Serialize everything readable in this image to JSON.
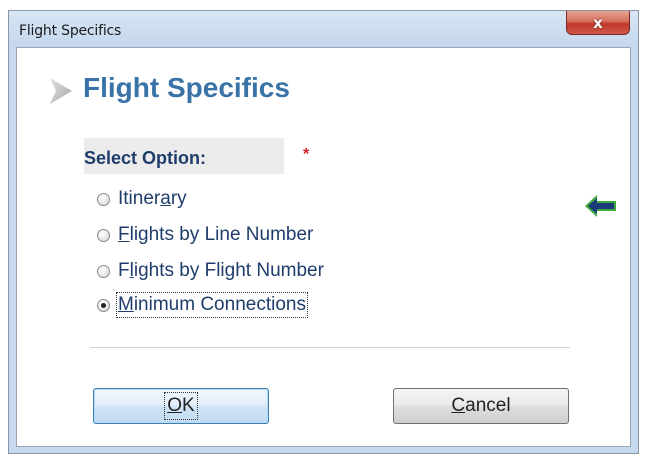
{
  "window": {
    "title": "Flight Specifics",
    "close_glyph": "x"
  },
  "header": {
    "title": "Flight Specifics",
    "arrow_icon": "chevron-right-icon"
  },
  "form": {
    "select_label": "Select Option:",
    "required_marker": "*",
    "options": [
      {
        "pre": "Itiner",
        "mnemonic": "a",
        "post": "ry",
        "checked": false
      },
      {
        "pre": "",
        "mnemonic": "F",
        "post": "lights by Line Number",
        "checked": false
      },
      {
        "pre": "F",
        "mnemonic": "l",
        "post": "ights by Flight Number",
        "checked": false
      },
      {
        "pre": "",
        "mnemonic": "M",
        "post": "inimum Connections",
        "checked": true
      }
    ]
  },
  "buttons": {
    "ok": {
      "pre": "",
      "mnemonic": "O",
      "post": "K"
    },
    "cancel": {
      "pre": "",
      "mnemonic": "C",
      "post": "ancel"
    }
  },
  "colors": {
    "heading": "#3a73a8",
    "label": "#1f3d6b",
    "required": "#d22020",
    "nav_arrow": "#1a3a7a",
    "nav_arrow_glow": "#3fa83f"
  }
}
